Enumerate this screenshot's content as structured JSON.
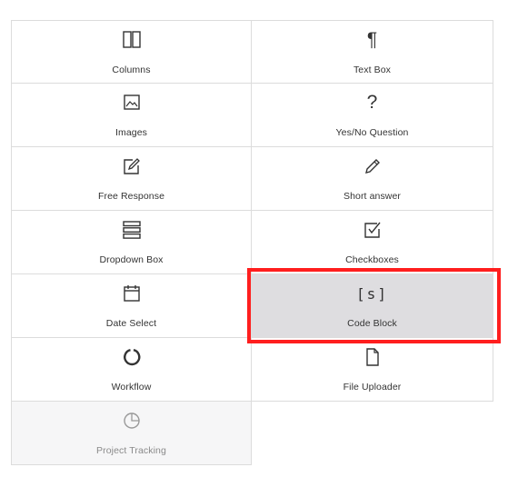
{
  "items": [
    {
      "label": "Columns",
      "icon": "columns-icon"
    },
    {
      "label": "Text Box",
      "icon": "pilcrow-icon",
      "glyph": "¶"
    },
    {
      "label": "Images",
      "icon": "image-icon"
    },
    {
      "label": "Yes/No Question",
      "icon": "question-icon",
      "glyph": "?"
    },
    {
      "label": "Free Response",
      "icon": "edit-square-icon"
    },
    {
      "label": "Short answer",
      "icon": "pencil-icon"
    },
    {
      "label": "Dropdown Box",
      "icon": "list-icon"
    },
    {
      "label": "Checkboxes",
      "icon": "checkbox-icon"
    },
    {
      "label": "Date Select",
      "icon": "calendar-icon"
    },
    {
      "label": "Code Block",
      "icon": "code-icon",
      "glyph": "[s]"
    },
    {
      "label": "Workflow",
      "icon": "circle-icon"
    },
    {
      "label": "File Uploader",
      "icon": "file-icon"
    },
    {
      "label": "Project Tracking",
      "icon": "pie-chart-icon"
    }
  ],
  "selected_index": 9,
  "highlight_color": "#ff1e1e"
}
